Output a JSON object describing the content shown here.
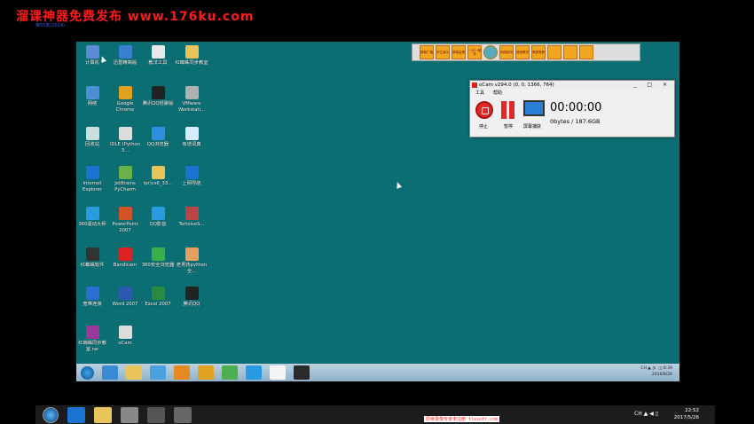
{
  "watermark": {
    "title": "溜课神器免费发布 www.176ku.com",
    "sub": "第55批(2014)"
  },
  "desktop_icons": [
    {
      "label": "计算机",
      "color": "#5b8ad6"
    },
    {
      "label": "迅雷精简版",
      "color": "#3a7fd0"
    },
    {
      "label": "教法工具",
      "color": "#e8e8e8"
    },
    {
      "label": "红蜘蛛同步教室",
      "color": "#e8c45a"
    },
    {
      "label": "网络",
      "color": "#4d8fd6"
    },
    {
      "label": "Google Chrome",
      "color": "#e0a020"
    },
    {
      "label": "腾讯QQ轻聊版",
      "color": "#222"
    },
    {
      "label": "VMware Workstati...",
      "color": "#b0b0b0"
    },
    {
      "label": "回收站",
      "color": "#cdd"
    },
    {
      "label": "IDLE (Python 3...",
      "color": "#ddd"
    },
    {
      "label": "QQ浏览器",
      "color": "#2f8fe0"
    },
    {
      "label": "有道词典",
      "color": "#d8ecff"
    },
    {
      "label": "Internet Explorer",
      "color": "#1a73d0"
    },
    {
      "label": "JetBrains PyCharm",
      "color": "#6ab04c"
    },
    {
      "label": "lpr)cs6_33...",
      "color": "#e8c45a"
    },
    {
      "label": "上网导航",
      "color": "#1a73d0"
    },
    {
      "label": "360驱动大师",
      "color": "#2a9be0"
    },
    {
      "label": "PowerPoint 2007",
      "color": "#d25428"
    },
    {
      "label": "QQ影音",
      "color": "#2a9be0"
    },
    {
      "label": "TortoiseS...",
      "color": "#b44"
    },
    {
      "label": "红蜘蛛软件",
      "color": "#333"
    },
    {
      "label": "Bandicam",
      "color": "#d22"
    },
    {
      "label": "360安全浏览器",
      "color": "#3ab04c"
    },
    {
      "label": "老男孩python全...",
      "color": "#e6a060"
    },
    {
      "label": "宽带连接",
      "color": "#2a6ed0"
    },
    {
      "label": "Word 2007",
      "color": "#2a5bb0"
    },
    {
      "label": "Excel 2007",
      "color": "#2a8a40"
    },
    {
      "label": "腾讯QQ",
      "color": "#222"
    },
    {
      "label": "红蜘蛛同步教室.rar",
      "color": "#9a3a9a"
    },
    {
      "label": "oCam",
      "color": "#ddd"
    }
  ],
  "toolbar": {
    "buttons": [
      "屏幕广播",
      "学生演示",
      "屏幕监看",
      "一对一辅导",
      "",
      "网络影院",
      "语音教学",
      "黑屏肃静",
      "",
      "",
      ""
    ]
  },
  "ocam": {
    "title": "oCam v294.0 (0, 0, 1366, 764)",
    "controls": "_ □ ×",
    "menu_tools": "工具",
    "menu_help": "帮助",
    "stop_label": "停止",
    "pause_label": "暂停",
    "screen_label": "屏幕捕获",
    "timer": "00:00:00",
    "size": "0bytes / 187.6GB"
  },
  "inner_taskbar": {
    "tray_text": "CH ▲ 🔊 ◫",
    "time": "8:39",
    "date": "2016/8/26",
    "icons": [
      "#3a8ad6",
      "#e8c45a",
      "#4da0e0",
      "#e68a20",
      "#e0a020",
      "#4caf50",
      "#2a9be0",
      "#f5f5f5",
      "#2a2a2a"
    ]
  },
  "outer_taskbar": {
    "tray_text": "CH ▲ ◀ ▯",
    "time": "22:52",
    "date": "2017/5/26",
    "icons": [
      "#1a73d0",
      "#e8c45a",
      "#888",
      "#555",
      "#666"
    ]
  },
  "banner": "原帝录像专家未注册 tlxsoft.com"
}
